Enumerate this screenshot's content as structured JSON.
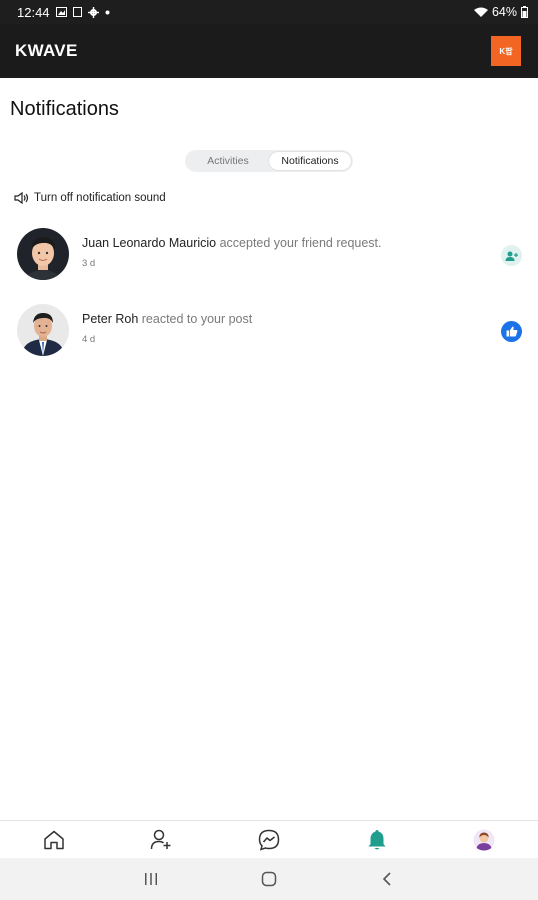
{
  "status_bar": {
    "time": "12:44",
    "battery": "64%",
    "icons": [
      "image-icon",
      "square-icon",
      "gear-icon",
      "dot-icon",
      "wifi-icon",
      "battery-icon"
    ]
  },
  "app_bar": {
    "title": "KWAVE",
    "logo_text": "K팝"
  },
  "page": {
    "title": "Notifications"
  },
  "tabs": [
    {
      "label": "Activities",
      "active": false
    },
    {
      "label": "Notifications",
      "active": true
    }
  ],
  "sound_toggle": {
    "label": "Turn off notification sound",
    "icon": "speaker-icon"
  },
  "notifications": [
    {
      "name": "Juan Leonardo Mauricio",
      "action": " accepted your friend request.",
      "time": "3 d",
      "badge_icon": "friend-accepted-icon",
      "badge_color": "#dff2ef"
    },
    {
      "name": "Peter Roh",
      "action": " reacted to your post",
      "time": "4 d",
      "badge_icon": "like-icon",
      "badge_color": "#1a73e8"
    }
  ],
  "bottom_nav": {
    "items": [
      "home-icon",
      "add-friend-icon",
      "messenger-icon",
      "bell-icon",
      "profile-icon"
    ],
    "active_color": "#1f9e8e"
  },
  "system_nav": [
    "recents-icon",
    "home-circle-icon",
    "back-icon"
  ]
}
